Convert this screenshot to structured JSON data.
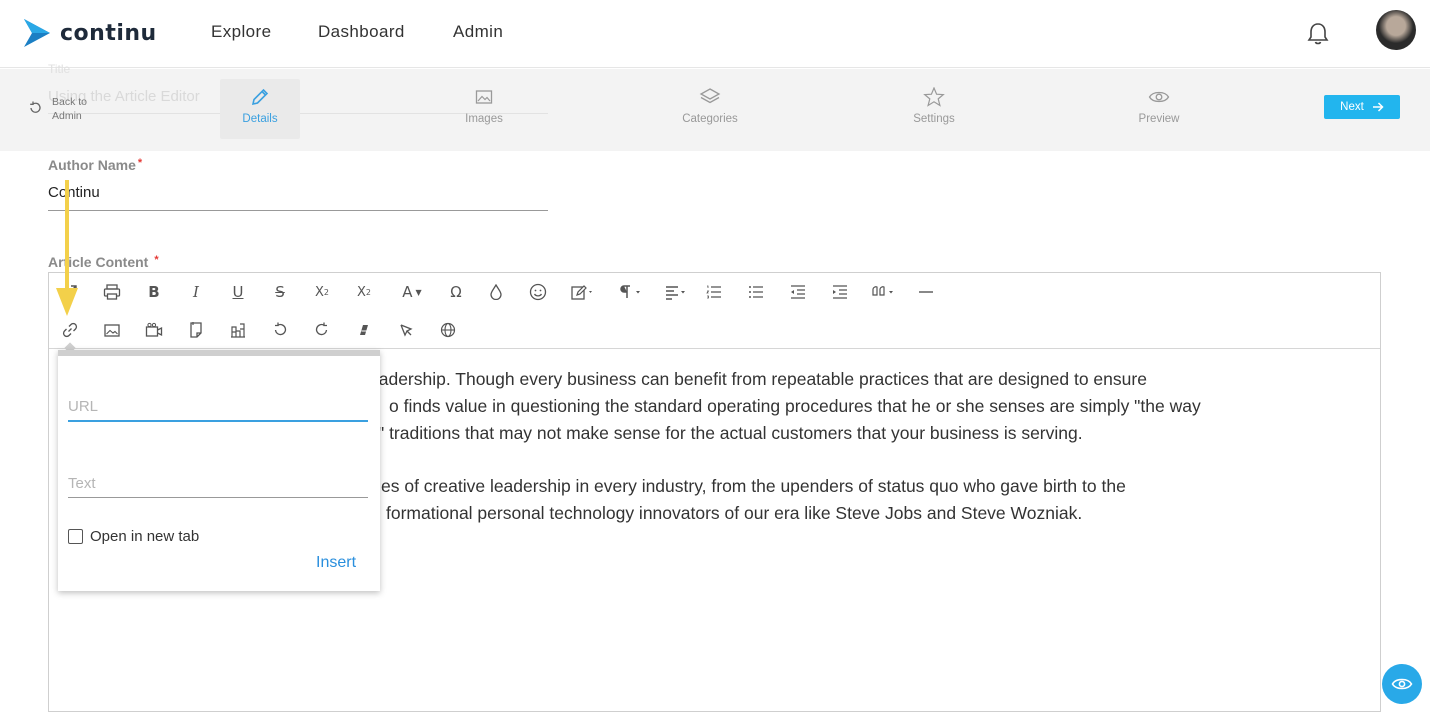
{
  "brand": {
    "name": "continu"
  },
  "nav": {
    "items": [
      "Explore",
      "Dashboard",
      "Admin"
    ]
  },
  "stepbar": {
    "ghost_title_label": "Title",
    "ghost_title_value": "Using the Article Editor",
    "back_label": "Back to Admin",
    "steps": [
      {
        "label": "Details",
        "icon": "pencil-icon",
        "active": true
      },
      {
        "label": "Images",
        "icon": "image-icon",
        "active": false
      },
      {
        "label": "Categories",
        "icon": "layers-icon",
        "active": false
      },
      {
        "label": "Settings",
        "icon": "star-icon",
        "active": false
      },
      {
        "label": "Preview",
        "icon": "eye-icon",
        "active": false
      }
    ],
    "next_label": "Next"
  },
  "form": {
    "author_label": "Author Name",
    "author_value": "Continu",
    "required_mark": "*",
    "content_label": "Article Content"
  },
  "editor": {
    "paragraphs": [
      [
        "eadership. Though every business can benefit from repeatable practices that are designed to ensure",
        "o finds value in questioning the standard operating procedures that he or she senses are simply \"the way",
        "\" traditions that may not make sense for the actual customers that your business is serving."
      ],
      [
        "es of creative leadership in every industry, from the upenders of status quo who gave birth to the",
        "formational personal technology innovators of our era like Steve Jobs and Steve Wozniak."
      ]
    ]
  },
  "link_popup": {
    "url_placeholder": "URL",
    "text_placeholder": "Text",
    "new_tab_label": "Open in new tab",
    "insert_label": "Insert"
  },
  "colors": {
    "accent": "#22b5ee",
    "link": "#2a8fdd",
    "annotation": "#f3d04a"
  }
}
